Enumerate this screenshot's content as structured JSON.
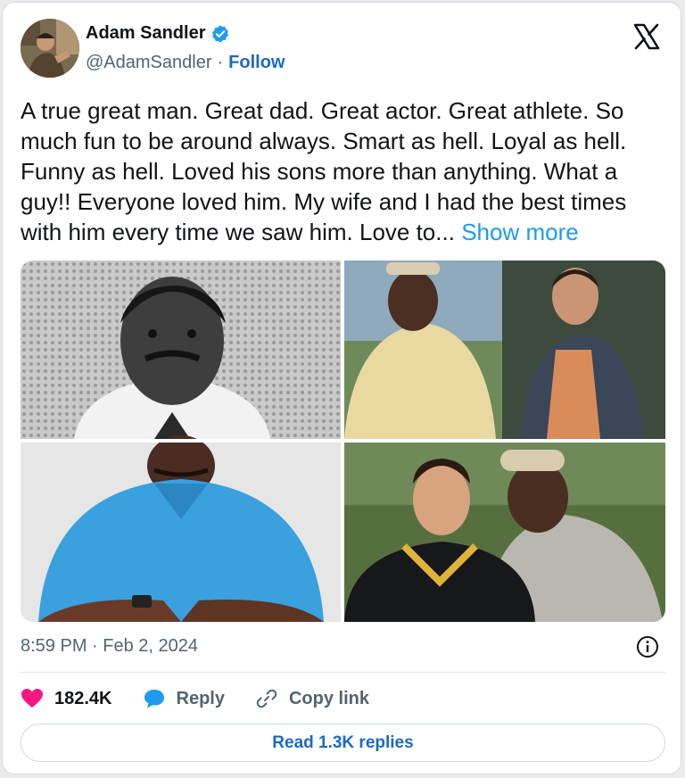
{
  "author": {
    "name": "Adam Sandler",
    "handle": "@AdamSandler",
    "separator": "·",
    "follow_label": "Follow"
  },
  "tweet": {
    "text": "A true great man. Great dad. Great actor. Great athlete.  So much fun to be around always. Smart as hell. Loyal as hell. Funny as hell. Loved his sons more than anything. What a guy!! Everyone loved him. My wife and I had the best times with him every time we saw him. Love to...",
    "show_more_label": "Show more",
    "timestamp": "8:59 PM · Feb 2, 2024"
  },
  "actions": {
    "likes_count": "182.4K",
    "reply_label": "Reply",
    "copy_link_label": "Copy link",
    "read_replies_label": "Read 1.3K replies"
  },
  "icons": {
    "verified": "verified-badge-icon",
    "logo": "x-logo-icon",
    "info": "info-icon",
    "like": "heart-icon",
    "reply": "reply-bubble-icon",
    "link": "link-icon"
  },
  "colors": {
    "accent": "#1d9bf0",
    "like": "#f91880",
    "text": "#0f1419",
    "muted": "#536471"
  }
}
